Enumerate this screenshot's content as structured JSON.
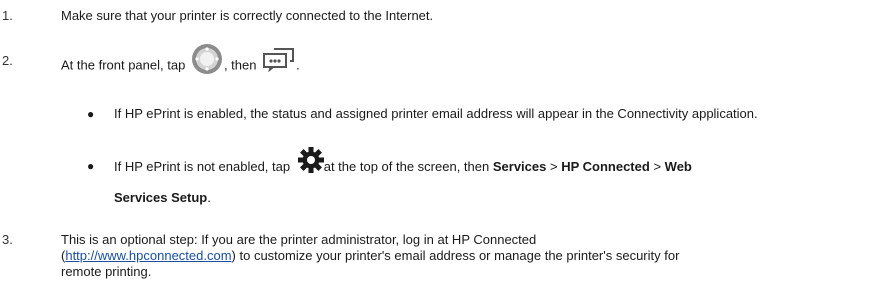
{
  "steps": [
    {
      "number": "1.",
      "text": "Make sure that your printer is correctly connected to the Internet."
    },
    {
      "number": "2.",
      "text_before": "At the front panel, tap",
      "text_middle": ", then",
      "text_after": "."
    },
    {
      "number": "3.",
      "text_before": "This is an optional step: If you are the printer administrator, log in at HP Connected (",
      "link": "http://www.hpconnected.com",
      "text_after": ") to customize your printer's email address or manage the printer's security for remote printing."
    }
  ],
  "bullets": [
    {
      "marker": "●",
      "text": "If HP ePrint is enabled, the status and assigned printer email address will appear in the Connectivity application."
    },
    {
      "marker": "●",
      "text_before": "If HP ePrint is not enabled, tap",
      "text_middle": "at the top of the screen, then",
      "services": "Services",
      "sep1": ">",
      "hp_connected": "HP Connected",
      "sep2": ">",
      "web": "Web",
      "services_setup": "Services Setup",
      "end": "."
    }
  ],
  "icons": {
    "connectivity": "connectivity-icon",
    "chat": "chat-bubbles-icon",
    "gear": "gear-icon"
  }
}
